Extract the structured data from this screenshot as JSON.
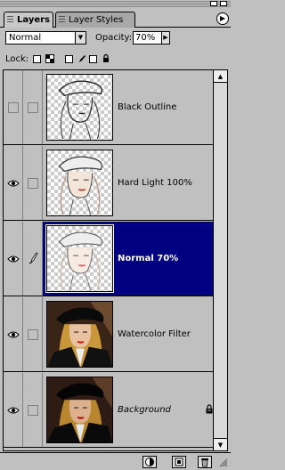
{
  "tabs": [
    {
      "label": "Layers",
      "active": true
    },
    {
      "label": "Layer Styles",
      "active": false
    }
  ],
  "panel_menu_icon": "triangle-right-icon",
  "blend_mode": {
    "value": "Normal"
  },
  "opacity": {
    "label": "Opacity:",
    "value": "70%"
  },
  "lock": {
    "label": "Lock:"
  },
  "layers": [
    {
      "name": "Black Outline",
      "visible": false,
      "selected": false,
      "italic": false,
      "thumb": "outline"
    },
    {
      "name": "Hard Light 100%",
      "visible": true,
      "selected": false,
      "italic": false,
      "thumb": "outline-color"
    },
    {
      "name": "Normal 70%",
      "visible": true,
      "selected": true,
      "italic": false,
      "thumb": "outline-color"
    },
    {
      "name": "Watercolor Filter",
      "visible": true,
      "selected": false,
      "italic": false,
      "thumb": "photo"
    },
    {
      "name": "Background",
      "visible": true,
      "selected": false,
      "italic": true,
      "thumb": "photo",
      "locked": true
    }
  ],
  "colors": {
    "panel": "#c0c0c0",
    "selection": "#000080"
  }
}
